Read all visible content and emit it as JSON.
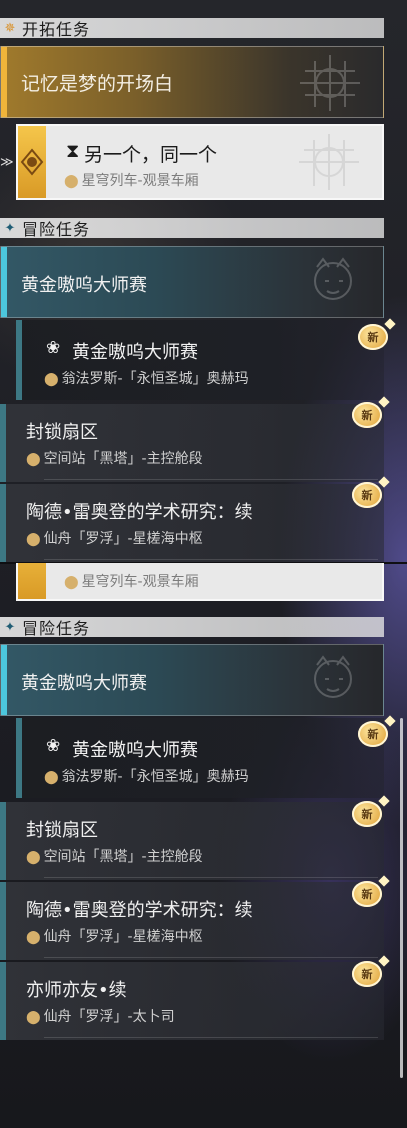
{
  "panel1": {
    "trailblaze_header": "开拓任务",
    "trailblaze_main": "记忆是梦的开场白",
    "selected_quest": {
      "title": "另一个，同一个",
      "location": "星穹列车-观景车厢"
    },
    "adventure_header": "冒险任务",
    "adventure_main": "黄金嗷呜大师赛",
    "sub_quest": {
      "title": "黄金嗷呜大师赛",
      "location": "翁法罗斯-「永恒圣城」奥赫玛",
      "new": "新"
    },
    "quests": [
      {
        "title": "封锁扇区",
        "location": "空间站「黑塔」-主控舱段",
        "new": "新"
      },
      {
        "title": "陶德•雷奥登的学术研究：续",
        "location": "仙舟「罗浮」-星槎海中枢",
        "new": "新"
      }
    ]
  },
  "panel2": {
    "partial_location": "星穹列车-观景车厢",
    "adventure_header": "冒险任务",
    "adventure_main": "黄金嗷呜大师赛",
    "sub_quest": {
      "title": "黄金嗷呜大师赛",
      "location": "翁法罗斯-「永恒圣城」奥赫玛",
      "new": "新"
    },
    "quests": [
      {
        "title": "封锁扇区",
        "location": "空间站「黑塔」-主控舱段",
        "new": "新"
      },
      {
        "title": "陶德•雷奥登的学术研究：续",
        "location": "仙舟「罗浮」-星槎海中枢",
        "new": "新"
      },
      {
        "title": "亦师亦友•续",
        "location": "仙舟「罗浮」-太卜司",
        "new": "新"
      }
    ]
  },
  "colors": {
    "trailblaze_accent": "#f0b43a",
    "adventure_accent": "#4cc6dc",
    "new_badge": "#e6b04c"
  }
}
